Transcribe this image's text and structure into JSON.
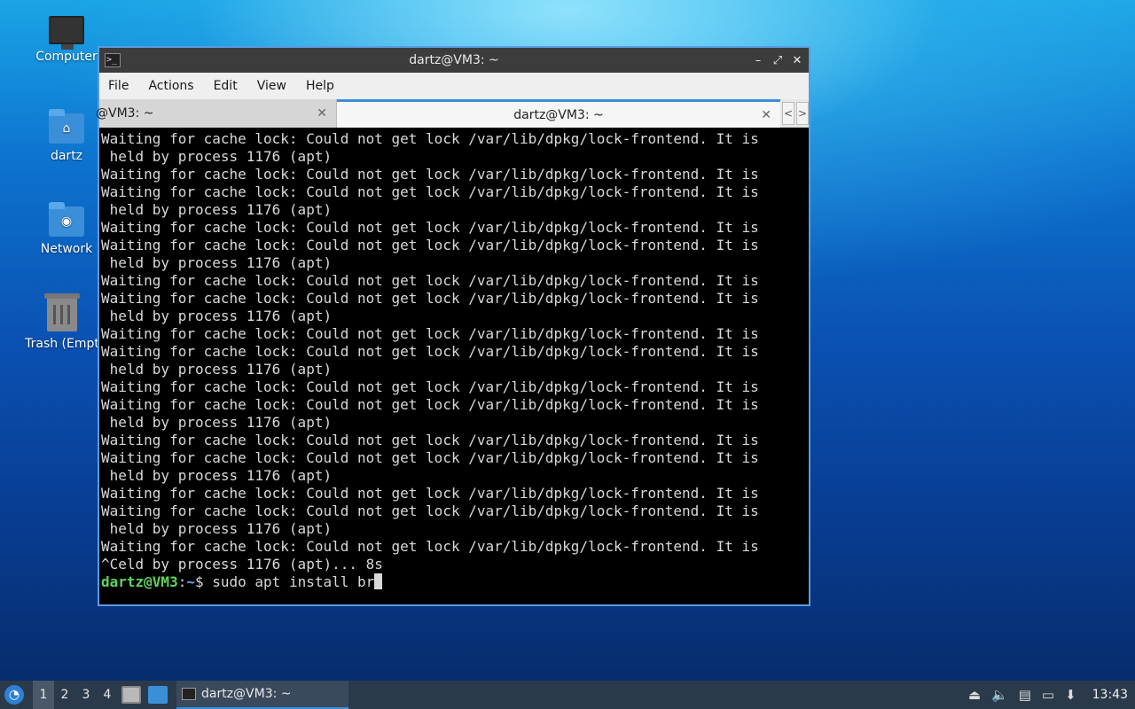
{
  "desktop": {
    "icons": [
      {
        "label": "Computer",
        "icon": "computer-icon"
      },
      {
        "label": "dartz",
        "icon": "home-folder-icon"
      },
      {
        "label": "Network",
        "icon": "network-folder-icon"
      },
      {
        "label": "Trash (Empt",
        "icon": "trash-icon"
      }
    ]
  },
  "window": {
    "title": "dartz@VM3: ~",
    "controls": {
      "minimize": "–",
      "maximize": "⤢",
      "close": "✕"
    },
    "menu": [
      "File",
      "Actions",
      "Edit",
      "View",
      "Help"
    ],
    "tabs": [
      {
        "label": "@VM3: ~",
        "active": false,
        "close": "✕"
      },
      {
        "label": "dartz@VM3: ~",
        "active": true,
        "close": "✕"
      }
    ],
    "tab_nav": {
      "prev": "<",
      "next": ">"
    }
  },
  "terminal": {
    "lines": [
      "Waiting for cache lock: Could not get lock /var/lib/dpkg/lock-frontend. It is",
      " held by process 1176 (apt)",
      "Waiting for cache lock: Could not get lock /var/lib/dpkg/lock-frontend. It is",
      "Waiting for cache lock: Could not get lock /var/lib/dpkg/lock-frontend. It is",
      " held by process 1176 (apt)",
      "Waiting for cache lock: Could not get lock /var/lib/dpkg/lock-frontend. It is",
      "Waiting for cache lock: Could not get lock /var/lib/dpkg/lock-frontend. It is",
      " held by process 1176 (apt)",
      "Waiting for cache lock: Could not get lock /var/lib/dpkg/lock-frontend. It is",
      "Waiting for cache lock: Could not get lock /var/lib/dpkg/lock-frontend. It is",
      " held by process 1176 (apt)",
      "Waiting for cache lock: Could not get lock /var/lib/dpkg/lock-frontend. It is",
      "Waiting for cache lock: Could not get lock /var/lib/dpkg/lock-frontend. It is",
      " held by process 1176 (apt)",
      "Waiting for cache lock: Could not get lock /var/lib/dpkg/lock-frontend. It is",
      "Waiting for cache lock: Could not get lock /var/lib/dpkg/lock-frontend. It is",
      " held by process 1176 (apt)",
      "Waiting for cache lock: Could not get lock /var/lib/dpkg/lock-frontend. It is",
      "Waiting for cache lock: Could not get lock /var/lib/dpkg/lock-frontend. It is",
      " held by process 1176 (apt)",
      "Waiting for cache lock: Could not get lock /var/lib/dpkg/lock-frontend. It is",
      "Waiting for cache lock: Could not get lock /var/lib/dpkg/lock-frontend. It is",
      " held by process 1176 (apt)",
      "Waiting for cache lock: Could not get lock /var/lib/dpkg/lock-frontend. It is",
      "^Celd by process 1176 (apt)... 8s"
    ],
    "prompt_user": "dartz@VM3",
    "prompt_sep": ":",
    "prompt_path": "~",
    "prompt_symbol": "$ ",
    "command": "sudo apt install br"
  },
  "taskbar": {
    "workspaces": [
      "1",
      "2",
      "3",
      "4"
    ],
    "active_workspace": "1",
    "task_label": "dartz@VM3: ~",
    "tray_icons": [
      "eject-icon",
      "volume-icon",
      "clipboard-icon",
      "network-icon",
      "update-icon"
    ],
    "clock": "13:43",
    "accent": "#3b8fd9"
  }
}
